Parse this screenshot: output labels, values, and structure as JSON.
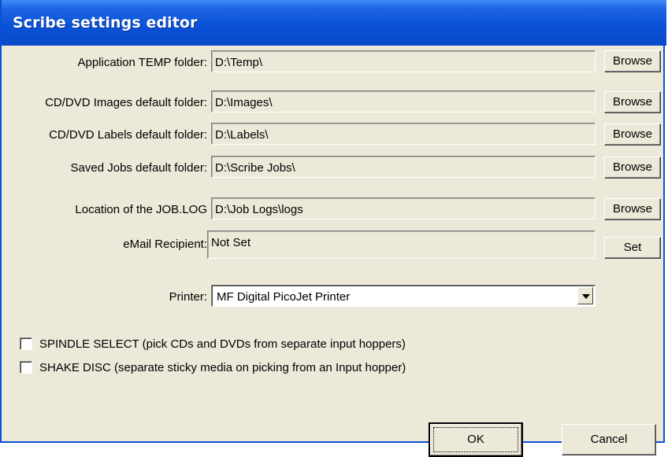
{
  "window": {
    "title": "Scribe settings editor"
  },
  "rows": [
    {
      "label": "Application TEMP folder:",
      "value": "D:\\Temp\\",
      "button": "Browse"
    },
    {
      "label": "CD/DVD Images default folder:",
      "value": "D:\\Images\\",
      "button": "Browse"
    },
    {
      "label": "CD/DVD Labels default folder:",
      "value": "D:\\Labels\\",
      "button": "Browse"
    },
    {
      "label": "Saved Jobs default folder:",
      "value": "D:\\Scribe Jobs\\",
      "button": "Browse"
    },
    {
      "label": "Location of the JOB.LOG",
      "value": "D:\\Job Logs\\logs",
      "button": "Browse"
    },
    {
      "label": "eMail Recipient:",
      "value": "Not Set",
      "button": "Set"
    }
  ],
  "printer": {
    "label": "Printer:",
    "selected": "MF Digital PicoJet Printer"
  },
  "options": [
    {
      "label": "SPINDLE SELECT (pick CDs and DVDs from separate input hoppers)",
      "checked": false
    },
    {
      "label": "SHAKE DISC (separate sticky media on picking from an Input hopper)",
      "checked": false
    }
  ],
  "buttons": {
    "ok": "OK",
    "cancel": "Cancel"
  },
  "colors": {
    "titlebar": "#0a52d8",
    "dialog_bg": "#ece9d8"
  }
}
